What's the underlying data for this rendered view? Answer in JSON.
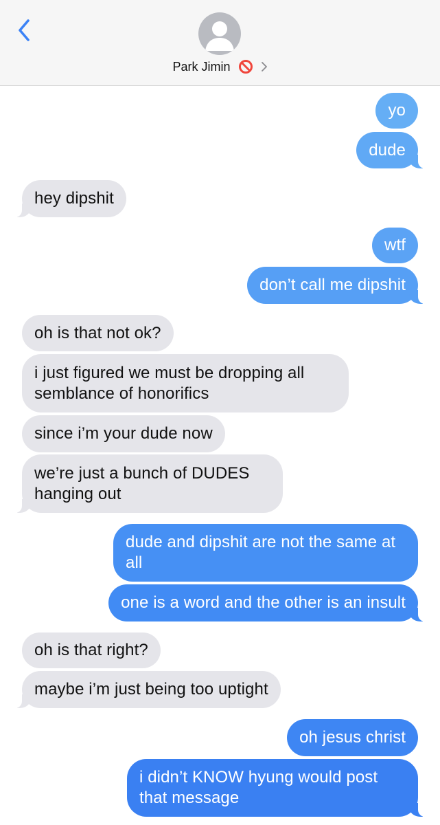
{
  "header": {
    "contact_name": "Park Jimin",
    "status_icon": "no-entry-icon",
    "back_icon": "chevron-left-icon",
    "avatar_icon": "person-silhouette-icon",
    "accent_color": "#3b82f6"
  },
  "messages": [
    {
      "from": "me",
      "text": "yo",
      "color": "#65aef5"
    },
    {
      "from": "me",
      "text": "dude",
      "color": "#60a9f5"
    },
    {
      "from": "them",
      "text": "hey dipshit"
    },
    {
      "from": "me",
      "text": "wtf",
      "color": "#5ba3f5"
    },
    {
      "from": "me",
      "text": "don’t call me dipshit",
      "color": "#569ff5"
    },
    {
      "from": "them",
      "text": "oh is that not ok?"
    },
    {
      "from": "them",
      "text": "i just figured we must be dropping all semblance of honorifics"
    },
    {
      "from": "them",
      "text": "since i’m your dude now"
    },
    {
      "from": "them",
      "text": "we’re just a bunch of DUDES hanging out"
    },
    {
      "from": "me",
      "text": "dude and dipshit are not the same at all",
      "color": "#4690f4"
    },
    {
      "from": "me",
      "text": "one is a word and the other is an insult",
      "color": "#418bf4"
    },
    {
      "from": "them",
      "text": "oh is that right?"
    },
    {
      "from": "them",
      "text": "maybe i’m just being too uptight"
    },
    {
      "from": "me",
      "text": "oh jesus christ",
      "color": "#3e86f3"
    },
    {
      "from": "me",
      "text": "i didn’t KNOW hyung would post that message",
      "color": "#3a80f2"
    }
  ]
}
